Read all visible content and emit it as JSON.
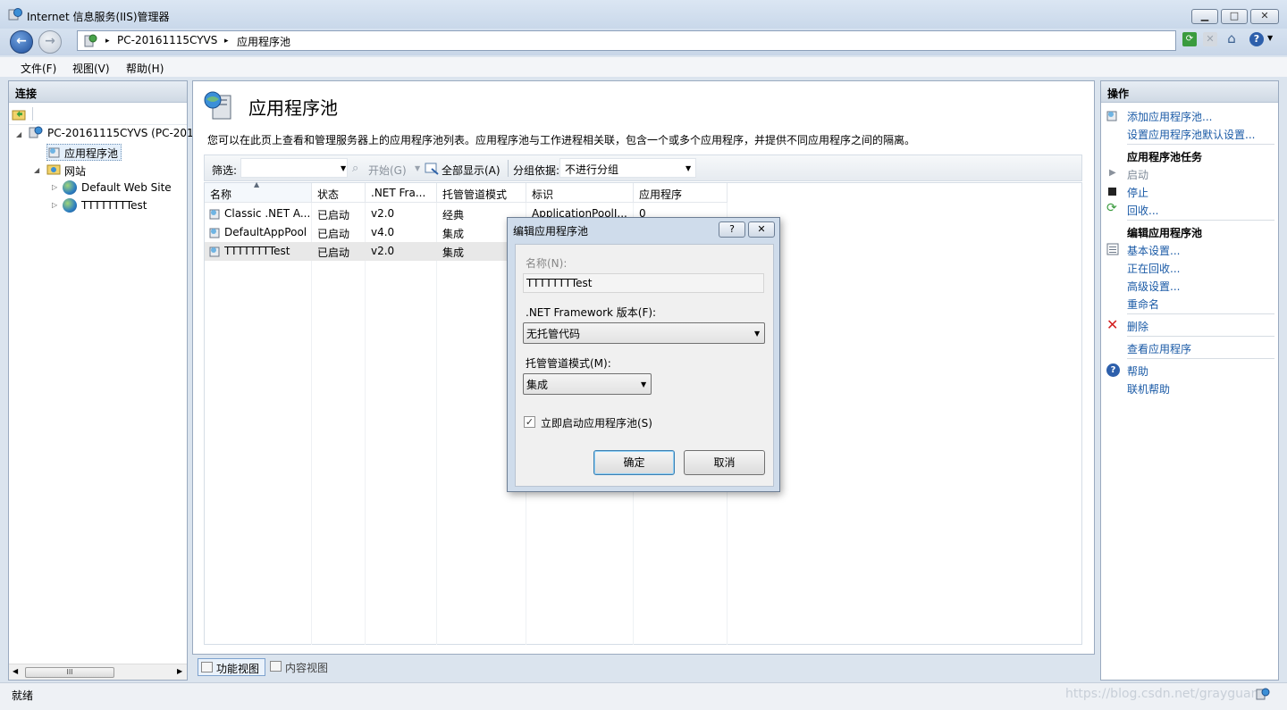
{
  "window": {
    "title": "Internet 信息服务(IIS)管理器",
    "minimize_glyph": "▁",
    "maximize_glyph": "□",
    "close_glyph": "✕"
  },
  "address": {
    "crumbs": [
      "PC-20161115CYVS",
      "应用程序池"
    ],
    "separator": "▸"
  },
  "menu": {
    "items": [
      "文件(F)",
      "视图(V)",
      "帮助(H)"
    ]
  },
  "connections": {
    "header": "连接",
    "tree": {
      "server": "PC-20161115CYVS (PC-201",
      "app_pools": "应用程序池",
      "sites": "网站",
      "site_items": [
        "Default Web Site",
        "TTTTTTTTest"
      ]
    },
    "scroll_label": "III"
  },
  "main": {
    "title": "应用程序池",
    "description": "您可以在此页上查看和管理服务器上的应用程序池列表。应用程序池与工作进程相关联，包含一个或多个应用程序，并提供不同应用程序之间的隔离。",
    "filter": {
      "label": "筛选:",
      "value": "",
      "start_label": "开始(G)",
      "show_all_label": "全部显示(A)",
      "group_by_label": "分组依据:",
      "group_by_value": "不进行分组"
    },
    "grid": {
      "columns": [
        "名称",
        "状态",
        ".NET Fra...",
        "托管管道模式",
        "标识",
        "应用程序"
      ],
      "rows": [
        [
          "Classic .NET A...",
          "已启动",
          "v2.0",
          "经典",
          "ApplicationPoolI...",
          "0"
        ],
        [
          "DefaultAppPool",
          "已启动",
          "v4.0",
          "集成",
          "",
          ""
        ],
        [
          "TTTTTTTTest",
          "已启动",
          "v2.0",
          "集成",
          "",
          ""
        ]
      ],
      "selected_row": 2
    },
    "tabs": {
      "feature_view": "功能视图",
      "content_view": "内容视图"
    }
  },
  "actions": {
    "header": "操作",
    "add_pool": "添加应用程序池...",
    "set_defaults": "设置应用程序池默认设置...",
    "tasks_title": "应用程序池任务",
    "start": "启动",
    "stop": "停止",
    "recycle": "回收...",
    "edit_title": "编辑应用程序池",
    "basic_settings": "基本设置...",
    "recycling": "正在回收...",
    "advanced_settings": "高级设置...",
    "rename": "重命名",
    "delete": "删除",
    "view_apps": "查看应用程序",
    "help": "帮助",
    "online_help": "联机帮助"
  },
  "dialog": {
    "title": "编辑应用程序池",
    "help_glyph": "?",
    "close_glyph": "✕",
    "name_label": "名称(N):",
    "name_value": "TTTTTTTTest",
    "framework_label": ".NET Framework 版本(F):",
    "framework_value": "无托管代码",
    "pipeline_label": "托管管道模式(M):",
    "pipeline_value": "集成",
    "start_immediately_label": "立即启动应用程序池(S)",
    "start_immediately_checked": true,
    "ok_label": "确定",
    "cancel_label": "取消"
  },
  "status": {
    "text": "就绪",
    "watermark": "https://blog.csdn.net/grayguan"
  },
  "colors": {
    "link": "#1a5aa6",
    "frame": "#dbe4ee",
    "dialog_frame": "#cfdceb"
  }
}
